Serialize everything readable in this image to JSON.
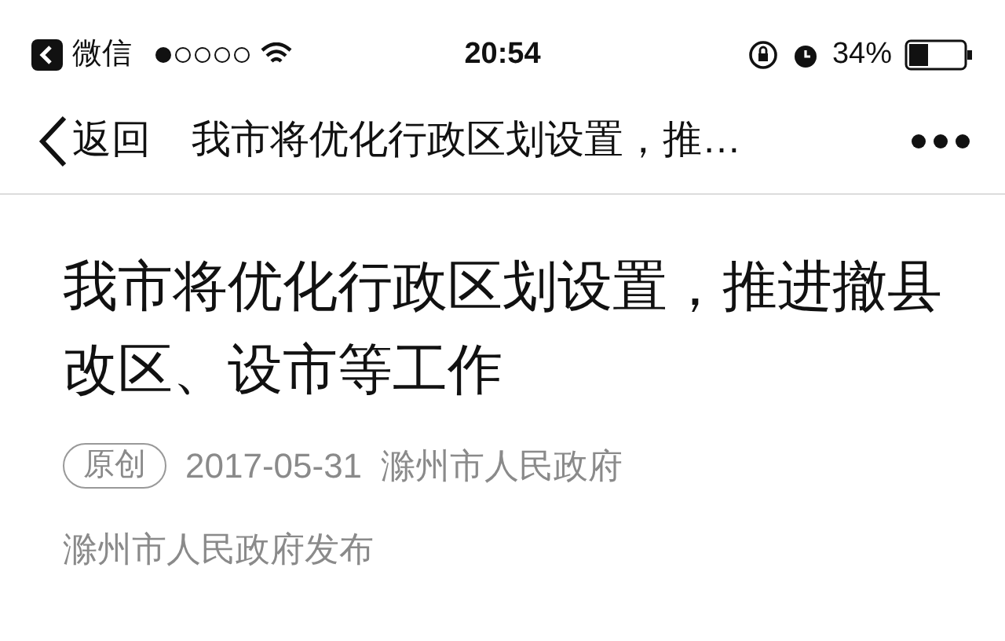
{
  "status_bar": {
    "back_app": "微信",
    "time": "20:54",
    "battery": "34%"
  },
  "nav": {
    "back": "返回",
    "title": "我市将优化行政区划设置，推…"
  },
  "article": {
    "title": "我市将优化行政区划设置，推进撤县改区、设市等工作",
    "tag": "原创",
    "date": "2017-05-31",
    "author": "滁州市人民政府",
    "byline": "滁州市人民政府发布"
  }
}
